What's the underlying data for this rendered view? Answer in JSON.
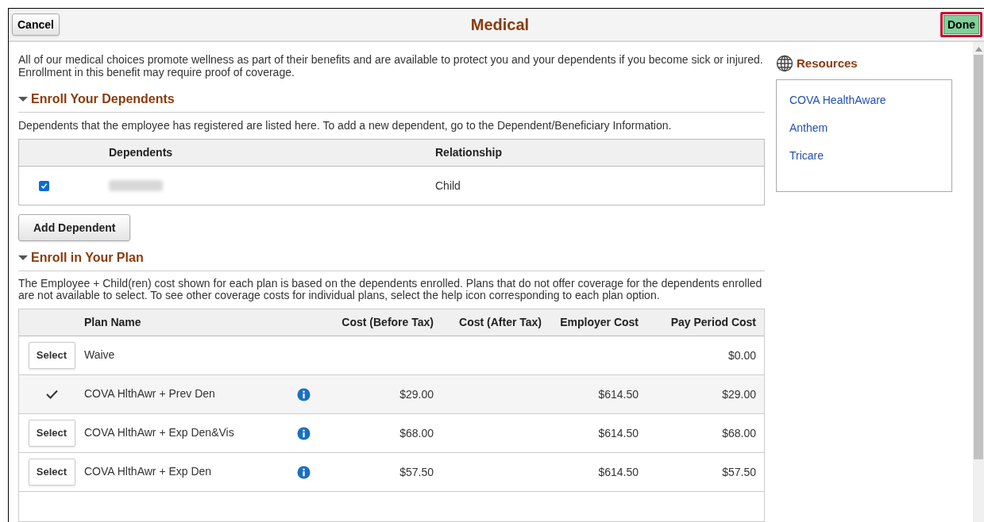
{
  "header": {
    "cancel": "Cancel",
    "title": "Medical",
    "done": "Done"
  },
  "intro": "All of our medical choices promote wellness as part of their benefits and are available to protect you and your dependents if you become sick or injured. Enrollment in this benefit may require proof of coverage.",
  "dependents_section": {
    "title": "Enroll Your Dependents",
    "expanded": true,
    "description": "Dependents that the employee has registered are listed here. To add a new dependent, go to the Dependent/Beneficiary Information.",
    "columns": [
      "Dependents",
      "Relationship"
    ],
    "rows": [
      {
        "checked": true,
        "relationship": "Child"
      }
    ],
    "add_button": "Add Dependent"
  },
  "plan_section": {
    "title": "Enroll in Your Plan",
    "expanded": true,
    "description": "The Employee + Child(ren) cost shown for each plan is based on the dependents enrolled. Plans that do not offer coverage for the dependents enrolled are not available to select. To see other coverage costs for individual plans, select the help icon corresponding to each plan option.",
    "columns": [
      "Plan Name",
      "Cost (Before Tax)",
      "Cost (After Tax)",
      "Employer Cost",
      "Pay Period Cost"
    ],
    "rows": [
      {
        "selected": false,
        "select_label": "Select",
        "plan": "Waive",
        "info": false,
        "cost_before": "",
        "employer": "",
        "pay_period": "$0.00"
      },
      {
        "selected": true,
        "select_label": "",
        "plan": "COVA HlthAwr + Prev Den",
        "info": true,
        "cost_before": "$29.00",
        "employer": "$614.50",
        "pay_period": "$29.00"
      },
      {
        "selected": false,
        "select_label": "Select",
        "plan": "COVA HlthAwr + Exp Den&Vis",
        "info": true,
        "cost_before": "$68.00",
        "employer": "$614.50",
        "pay_period": "$68.00"
      },
      {
        "selected": false,
        "select_label": "Select",
        "plan": "COVA HlthAwr + Exp Den",
        "info": true,
        "cost_before": "$57.50",
        "employer": "$614.50",
        "pay_period": "$57.50"
      }
    ]
  },
  "resources": {
    "title": "Resources",
    "links": [
      "COVA HealthAware",
      "Anthem",
      "Tricare"
    ]
  }
}
